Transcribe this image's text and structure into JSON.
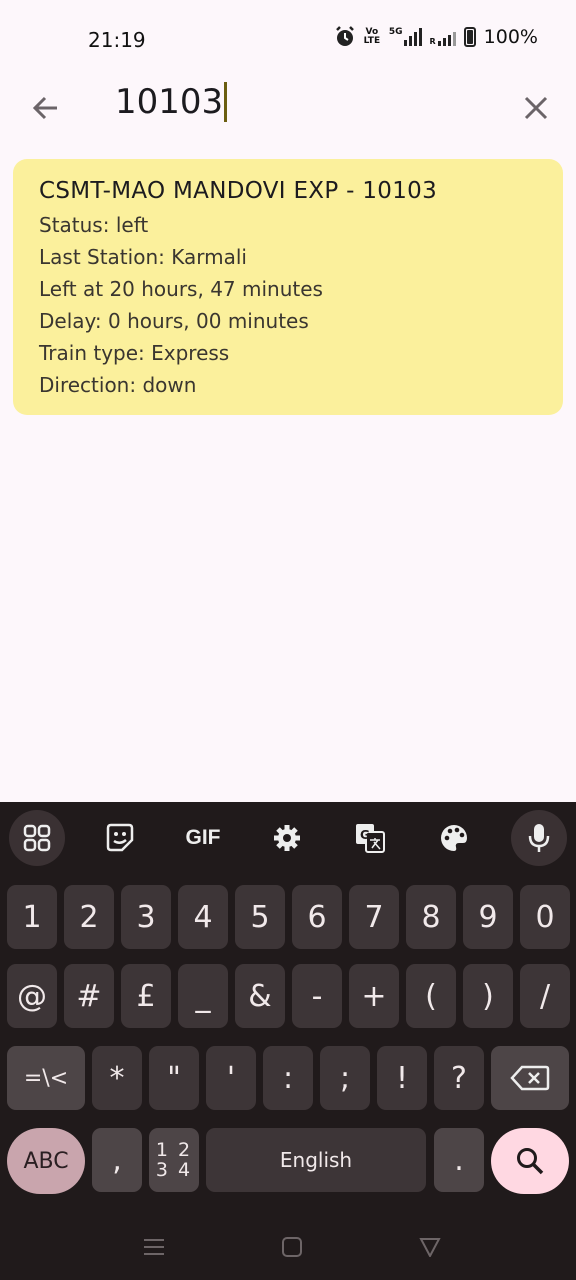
{
  "status_bar": {
    "time": "21:19",
    "battery_percent": "100%",
    "icons": [
      "alarm-icon",
      "volte-icon",
      "5g-signal-icon",
      "signal-icon",
      "battery-icon"
    ],
    "volte_label": "Vo LTE",
    "fiveg_label": "5G",
    "r_label": "R"
  },
  "search": {
    "query": "10103",
    "back_icon": "back-arrow-icon",
    "clear_icon": "close-icon"
  },
  "result_card": {
    "title": "CSMT-MAO MANDOVI EXP - 10103",
    "status": "Status: left",
    "last_station": "Last Station: Karmali",
    "left_at": "Left at 20 hours, 47 minutes",
    "delay": "Delay: 0 hours, 00 minutes",
    "train_type": "Train type: Express",
    "direction": "Direction: down",
    "background_color": "#fbf09c"
  },
  "keyboard": {
    "toolbar": [
      "apps-grid-icon",
      "sticker-icon",
      "gif-icon",
      "settings-icon",
      "translate-icon",
      "palette-icon",
      "microphone-icon"
    ],
    "gif_label": "GIF",
    "row1": [
      "1",
      "2",
      "3",
      "4",
      "5",
      "6",
      "7",
      "8",
      "9",
      "0"
    ],
    "row2": [
      "@",
      "#",
      "£",
      "_",
      "&",
      "-",
      "+",
      "(",
      ")",
      "/"
    ],
    "row3": [
      "=\\<",
      "*",
      "\"",
      "'",
      ":",
      ";",
      "!",
      "?"
    ],
    "abc_label": "ABC",
    "comma": ",",
    "nums_top": "1 2",
    "nums_bottom": "3 4",
    "space_label": "English",
    "period": "."
  },
  "nav_bar": [
    "menu-icon",
    "home-icon",
    "back-icon"
  ]
}
